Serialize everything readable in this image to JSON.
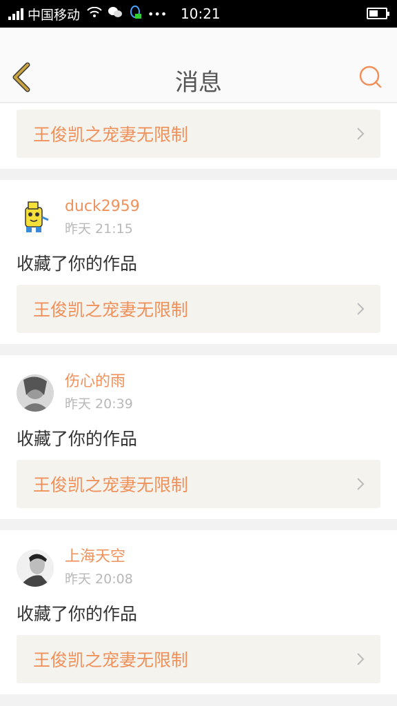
{
  "status_bar": {
    "carrier": "中国移动",
    "dots": "•••",
    "time": "10:21"
  },
  "header": {
    "title": "消息"
  },
  "first_item": {
    "work_title": "王俊凯之宠妻无限制"
  },
  "items": [
    {
      "username": "duck2959",
      "time": "昨天 21:15",
      "action": "收藏了你的作品",
      "work_title": "王俊凯之宠妻无限制"
    },
    {
      "username": "伤心的雨",
      "time": "昨天 20:39",
      "action": "收藏了你的作品",
      "work_title": "王俊凯之宠妻无限制"
    },
    {
      "username": "上海天空",
      "time": "昨天 20:08",
      "action": "收藏了你的作品",
      "work_title": "王俊凯之宠妻无限制"
    }
  ],
  "colors": {
    "accent": "#f0915c",
    "back_arrow": "#c9a440",
    "link_bg": "#f4f3ee"
  }
}
